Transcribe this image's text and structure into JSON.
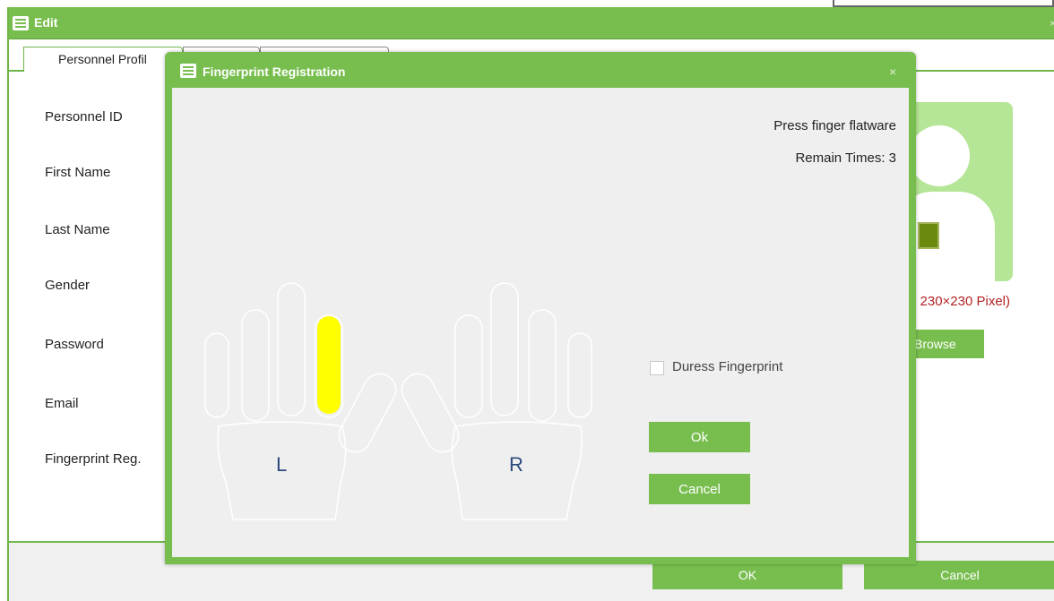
{
  "edit_window": {
    "title": "Edit",
    "close_symbol": "×",
    "tabs": [
      {
        "label": "Personnel Profil"
      },
      {
        "label": ""
      },
      {
        "label": ""
      }
    ],
    "form": {
      "labels": [
        "Personnel ID",
        "First Name",
        "Last Name",
        "Gender",
        "Password",
        "Email",
        "Fingerprint Reg."
      ]
    },
    "photo": {
      "note": "e 230×230 Pixel)",
      "browse_label": "Browse"
    },
    "ok_label": "OK",
    "cancel_label": "Cancel"
  },
  "fingerprint_dialog": {
    "title": "Fingerprint Registration",
    "close_symbol": "×",
    "instruction": "Press finger flatware",
    "remain": "Remain Times: 3",
    "left_hand_label": "L",
    "right_hand_label": "R",
    "selected_finger": "left-index",
    "highlight_color": "#ffff00",
    "duress_label": "Duress Fingerprint",
    "duress_checked": false,
    "ok_label": "Ok",
    "cancel_label": "Cancel"
  },
  "colors": {
    "accent": "#78be4e",
    "photo_bg": "#b5e596",
    "note_red": "#b22222",
    "hand_outline": "#ffffff"
  }
}
